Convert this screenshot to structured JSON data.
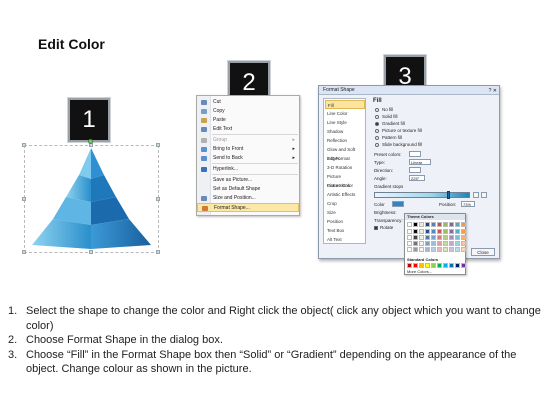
{
  "slide": {
    "title": "Edit Color"
  },
  "steps": [
    "1",
    "2",
    "3"
  ],
  "context_menu": {
    "items": [
      {
        "label": "Cut",
        "arrow": false,
        "disabled": false,
        "highlight": false,
        "icon": "scissors-icon"
      },
      {
        "label": "Copy",
        "arrow": false,
        "disabled": false,
        "highlight": false,
        "icon": "copy-icon"
      },
      {
        "label": "Paste",
        "arrow": false,
        "disabled": false,
        "highlight": false,
        "icon": "paste-icon"
      },
      {
        "label": "Edit Text",
        "arrow": false,
        "disabled": false,
        "highlight": false,
        "icon": "edit-text-icon"
      },
      {
        "label": "Group",
        "arrow": true,
        "disabled": true,
        "highlight": false,
        "icon": "group-icon"
      },
      {
        "label": "Bring to Front",
        "arrow": true,
        "disabled": false,
        "highlight": false,
        "icon": "bring-front-icon"
      },
      {
        "label": "Send to Back",
        "arrow": true,
        "disabled": false,
        "highlight": false,
        "icon": "send-back-icon"
      },
      {
        "label": "Hyperlink...",
        "arrow": false,
        "disabled": false,
        "highlight": false,
        "icon": "hyperlink-icon"
      },
      {
        "label": "Save as Picture...",
        "arrow": false,
        "disabled": false,
        "highlight": false,
        "icon": ""
      },
      {
        "label": "Set as Default Shape",
        "arrow": false,
        "disabled": false,
        "highlight": false,
        "icon": ""
      },
      {
        "label": "Size and Position...",
        "arrow": false,
        "disabled": false,
        "highlight": false,
        "icon": "size-icon"
      },
      {
        "label": "Format Shape...",
        "arrow": false,
        "disabled": false,
        "highlight": true,
        "icon": "format-icon"
      }
    ]
  },
  "format_dialog": {
    "title": "Format Shape",
    "categories": [
      "Fill",
      "Line Color",
      "Line Style",
      "Shadow",
      "Reflection",
      "Glow and Soft Edges",
      "3-D Format",
      "3-D Rotation",
      "Picture Corrections",
      "Picture Color",
      "Artistic Effects",
      "Crop",
      "Size",
      "Position",
      "Text Box",
      "Alt Text"
    ],
    "selected_category": "Fill",
    "fill_header": "Fill",
    "fill_options": [
      {
        "label": "No fill",
        "selected": false
      },
      {
        "label": "Solid fill",
        "selected": false
      },
      {
        "label": "Gradient fill",
        "selected": true
      },
      {
        "label": "Picture or texture fill",
        "selected": false
      },
      {
        "label": "Pattern fill",
        "selected": false
      },
      {
        "label": "Slide background fill",
        "selected": false
      }
    ],
    "preset_colors_label": "Preset colors:",
    "type_label": "Type:",
    "type_value": "Linear",
    "direction_label": "Direction:",
    "angle_label": "Angle:",
    "angle_value": "225°",
    "gradient_stops_label": "Gradient stops",
    "color_label": "Color",
    "position_label": "Position:",
    "position_value": "73%",
    "brightness_label": "Brightness:",
    "transparency_label": "Transparency:",
    "rotate_label": "Rotate",
    "close_label": "Close"
  },
  "palette": {
    "theme_label": "Theme Colors",
    "standard_label": "Standard Colors",
    "more_label": "More Colors...",
    "theme_colors": [
      "#ffffff",
      "#000000",
      "#eeece1",
      "#1f497d",
      "#4f81bd",
      "#c0504d",
      "#9bbb59",
      "#8064a2",
      "#4bacc6",
      "#f79646"
    ],
    "standard_colors": [
      "#c00000",
      "#ff0000",
      "#ffc000",
      "#ffff00",
      "#92d050",
      "#00b050",
      "#00b0f0",
      "#0070c0",
      "#002060",
      "#7030a0"
    ]
  },
  "instructions": [
    {
      "num": "1.",
      "text": "Select the shape to change the color and Right click the object( click any object which you want to change color)"
    },
    {
      "num": "2.",
      "text": "Choose Format Shape in the dialog box."
    },
    {
      "num": "3.",
      "text": "Choose “Fill” in the Format Shape box then “Solid” or “Gradient” depending on the appearance of the object. Change colour as shown in the picture."
    }
  ]
}
